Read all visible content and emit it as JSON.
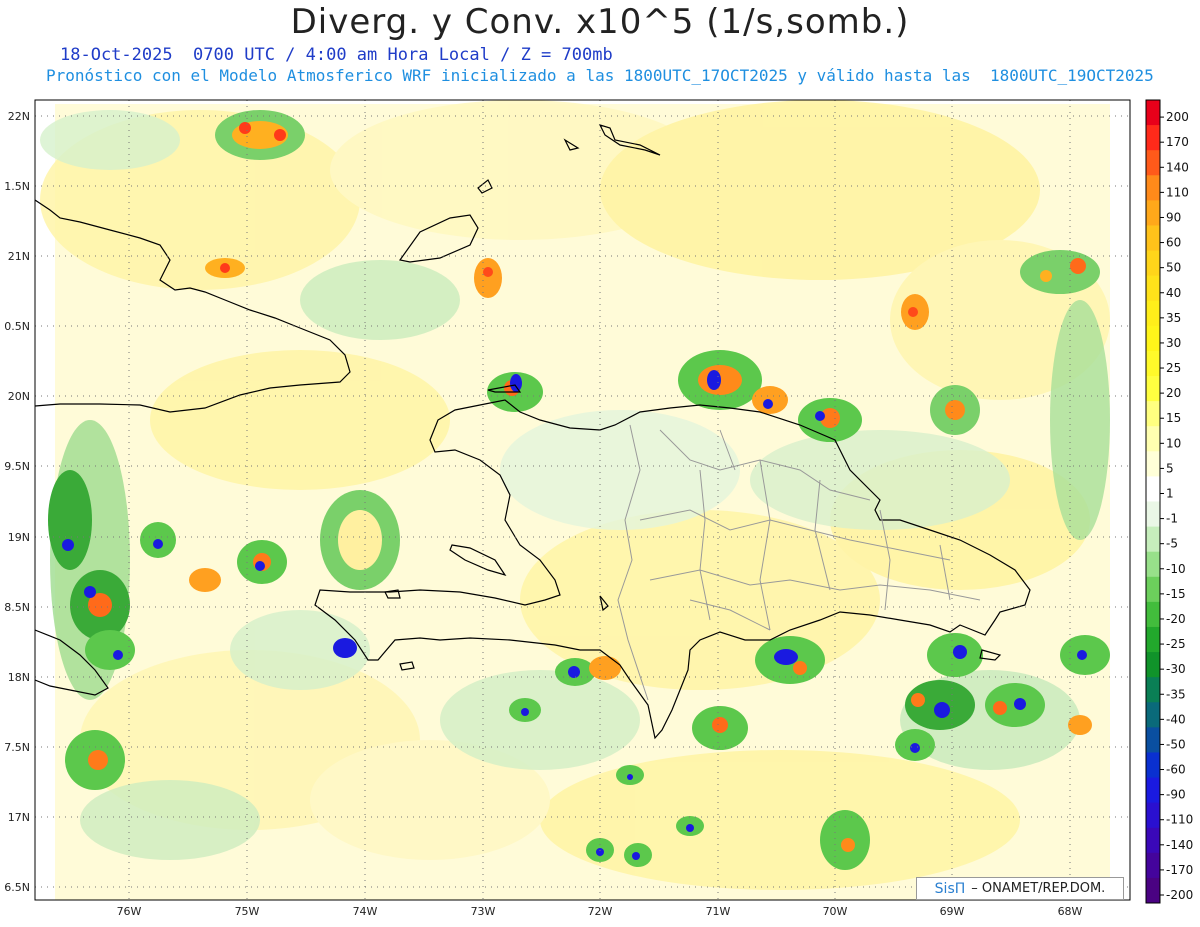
{
  "header": {
    "title": "Diverg. y Conv. x10^5 (1/s,somb.)",
    "line1": "18-Oct-2025  0700 UTC / 4:00 am Hora Local / Z = 700mb",
    "line2": "Pronóstico con el Modelo Atmosferico WRF inicializado a las 1800UTC_17OCT2025 y válido hasta las  1800UTC_19OCT2025"
  },
  "axes": {
    "lat_labels": [
      "22N",
      "1.5N",
      "21N",
      "0.5N",
      "20N",
      "9.5N",
      "19N",
      "8.5N",
      "18N",
      "7.5N",
      "17N",
      "6.5N"
    ],
    "lon_labels": [
      "76W",
      "75W",
      "74W",
      "73W",
      "72W",
      "71W",
      "70W",
      "69W",
      "68W"
    ]
  },
  "colorbar": {
    "levels": [
      "200",
      "170",
      "140",
      "110",
      "90",
      "60",
      "50",
      "40",
      "35",
      "30",
      "25",
      "20",
      "15",
      "10",
      "5",
      "1",
      "-1",
      "-5",
      "-10",
      "-15",
      "-20",
      "-25",
      "-30",
      "-35",
      "-40",
      "-50",
      "-60",
      "-90",
      "-110",
      "-140",
      "-170",
      "-200"
    ],
    "colors": [
      "#e8001a",
      "#ff2a1a",
      "#ff5a1a",
      "#ff8a1a",
      "#ffa81a",
      "#ffc21a",
      "#ffd51a",
      "#ffe21a",
      "#ffee1a",
      "#fff51a",
      "#fffa2a",
      "#ffff40",
      "#ffff80",
      "#ffffb0",
      "#ffffd8",
      "#ffffff",
      "#eaf7e6",
      "#c6eebc",
      "#98e08a",
      "#6ccf5c",
      "#42bd3c",
      "#22a82c",
      "#10932a",
      "#0a7f55",
      "#0a6a7a",
      "#0a4fa0",
      "#0a30d0",
      "#1a1ae0",
      "#2a10d0",
      "#3a08b8",
      "#44049c",
      "#4a0282"
    ]
  },
  "credit": {
    "logo": "SisΠ",
    "text": "– ONAMET/REP.DOM."
  }
}
